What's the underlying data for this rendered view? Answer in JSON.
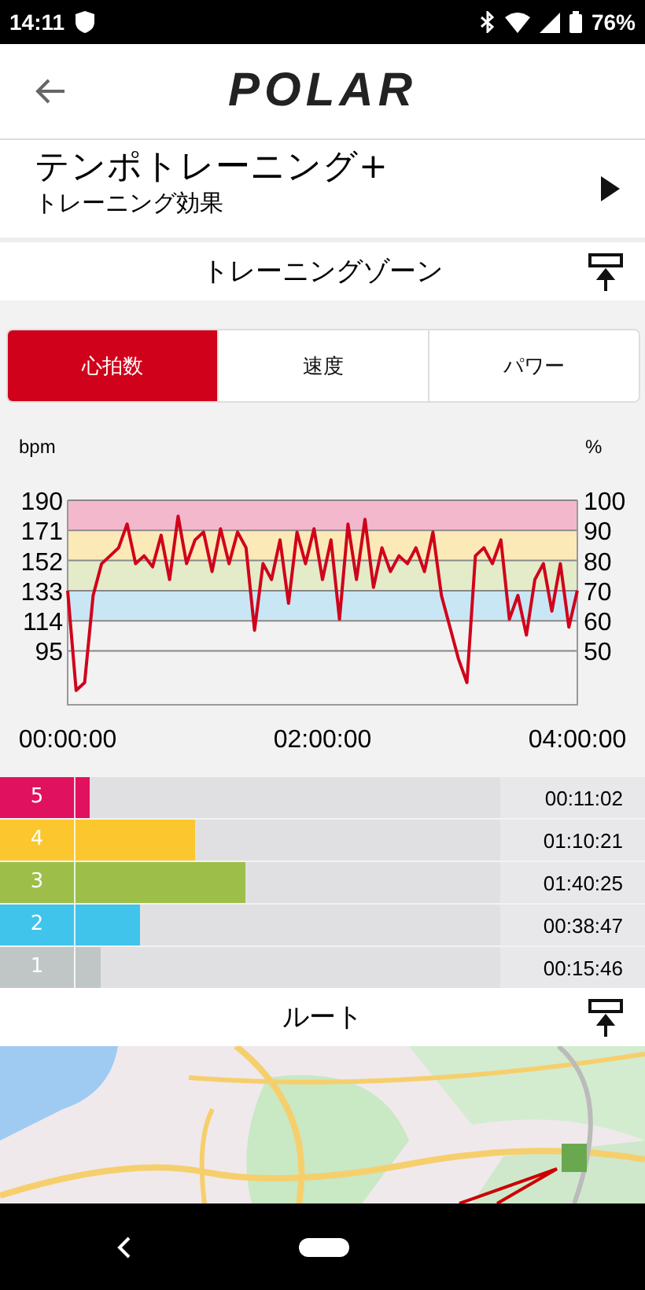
{
  "status_bar": {
    "time": "14:11",
    "battery": "76%"
  },
  "app_bar": {
    "logo": "POLAR"
  },
  "workout": {
    "title": "テンポトレーニング+",
    "subtitle": "トレーニング効果"
  },
  "zones_section": {
    "title": "トレーニングゾーン"
  },
  "tabs": [
    {
      "label": "心拍数",
      "selected": true
    },
    {
      "label": "速度",
      "selected": false
    },
    {
      "label": "パワー",
      "selected": false
    }
  ],
  "chart": {
    "right_unit": "%",
    "right_ticks": [
      "100",
      "90",
      "80",
      "70",
      "60",
      "50"
    ],
    "chart_data": {
      "type": "line",
      "ylabel": "bpm",
      "x": [
        0,
        4,
        8,
        12,
        16,
        20,
        24,
        28,
        32,
        36,
        40,
        44,
        48,
        52,
        56,
        60,
        64,
        68,
        72,
        76,
        80,
        84,
        88,
        92,
        96,
        100,
        104,
        108,
        112,
        116,
        120,
        124,
        128,
        132,
        136,
        140,
        144,
        148,
        152,
        156,
        160,
        164,
        168,
        172,
        176,
        180,
        184,
        188,
        192,
        196,
        200,
        204,
        208,
        212,
        216,
        220,
        224,
        228,
        232,
        236,
        240
      ],
      "grid": true,
      "bands": [
        {
          "axis": "y",
          "from": 171,
          "to": 190,
          "color": "#f4b8cc"
        },
        {
          "axis": "y",
          "from": 152,
          "to": 171,
          "color": "#fbe9b8"
        },
        {
          "axis": "y",
          "from": 133,
          "to": 152,
          "color": "#e3ebc8"
        },
        {
          "axis": "y",
          "from": 114,
          "to": 133,
          "color": "#c9e6f4"
        }
      ],
      "series": [
        {
          "color": "#d0021b",
          "values": [
            133,
            70,
            75,
            130,
            150,
            155,
            160,
            175,
            150,
            155,
            148,
            168,
            140,
            180,
            150,
            165,
            170,
            145,
            172,
            150,
            170,
            160,
            108,
            150,
            140,
            165,
            125,
            170,
            150,
            172,
            140,
            165,
            115,
            175,
            140,
            178,
            135,
            160,
            145,
            155,
            150,
            160,
            145,
            170,
            130,
            110,
            90,
            75,
            155,
            160,
            150,
            165,
            115,
            130,
            105,
            140,
            150,
            120,
            150,
            110,
            133
          ]
        }
      ],
      "xlim": [
        0,
        240
      ],
      "ylim": [
        61,
        190
      ],
      "xticks": [
        {
          "value": 0,
          "label": "00:00:00"
        },
        {
          "value": 120,
          "label": "02:00:00"
        },
        {
          "value": 240,
          "label": "04:00:00"
        }
      ],
      "yticks": [
        95,
        114,
        133,
        152,
        171,
        190
      ]
    }
  },
  "zones": [
    {
      "label": "5",
      "time": "00:11:02",
      "level": 0.18,
      "color": "#e0115f"
    },
    {
      "label": "4",
      "time": "01:10:21",
      "level": 0.39,
      "color": "#fcc62e"
    },
    {
      "label": "3",
      "time": "01:40:25",
      "level": 0.49,
      "color": "#9dbf4a"
    },
    {
      "label": "2",
      "time": "00:38:47",
      "level": 0.28,
      "color": "#40c4ec"
    },
    {
      "label": "1",
      "time": "00:15:46",
      "level": 0.2,
      "color": "#c0c6c6"
    }
  ],
  "route_section": {
    "title": "ルート"
  }
}
